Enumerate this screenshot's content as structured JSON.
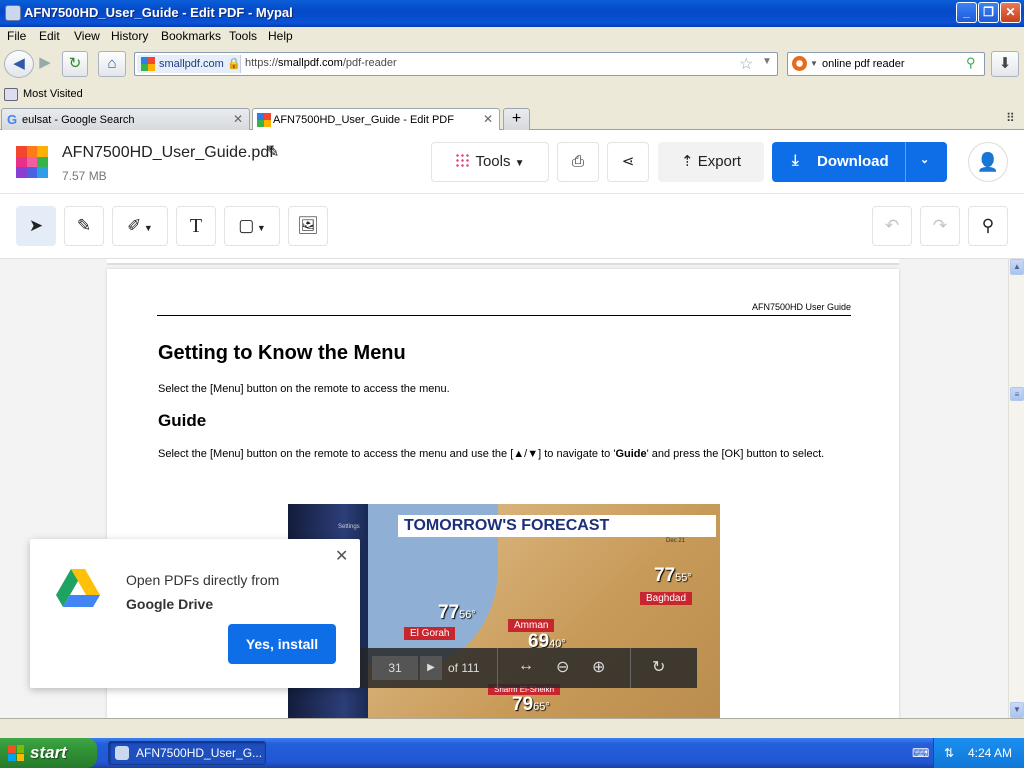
{
  "window": {
    "title": "AFN7500HD_User_Guide - Edit PDF - Mypal"
  },
  "menu": [
    "File",
    "Edit",
    "View",
    "History",
    "Bookmarks",
    "Tools",
    "Help"
  ],
  "address": {
    "site": "smallpdf.com",
    "url_prefix": "https://",
    "url_host": "smallpdf.com",
    "url_path": "/pdf-reader"
  },
  "search": {
    "value": "online pdf reader"
  },
  "bookmarks": {
    "most_visited": "Most Visited"
  },
  "tabs": [
    {
      "label": "eulsat - Google Search"
    },
    {
      "label": "AFN7500HD_User_Guide - Edit PDF"
    }
  ],
  "app": {
    "file_name": "AFN7500HD_User_Guide.pdf",
    "file_size": "7.57 MB",
    "tools_label": "Tools",
    "export_label": "Export",
    "download_label": "Download"
  },
  "document": {
    "header_right": "AFN7500HD User Guide",
    "heading": "Getting to Know the Menu",
    "para1": "Select the [Menu] button on the remote to access the menu.",
    "subheading": "Guide",
    "para2_a": "Select the [Menu] button on the remote to access the menu and use the [▲/▼] to navigate to '",
    "para2_bold": "Guide",
    "para2_b": "' and press the [OK] button to select.",
    "image": {
      "banner": "TOMORROW'S FORECAST",
      "side_label": "Settings",
      "side_label2": "de",
      "date": "Dec 21",
      "cities": [
        {
          "name": "Baghdad",
          "high": "77",
          "low": "55°"
        },
        {
          "name": "El Gorah",
          "high": "77",
          "low": "56°"
        },
        {
          "name": "Amman",
          "high": "69",
          "low": "40°"
        },
        {
          "name": "Sharm El-Sheikh",
          "high": "79",
          "low": "65°"
        }
      ]
    }
  },
  "pdf_controls": {
    "page": "31",
    "of_total": "of 111"
  },
  "popup": {
    "line1": "Open PDFs directly from",
    "line2": "Google Drive",
    "button": "Yes, install"
  },
  "taskbar": {
    "start": "start",
    "item": "AFN7500HD_User_G...",
    "clock": "4:24 AM"
  }
}
